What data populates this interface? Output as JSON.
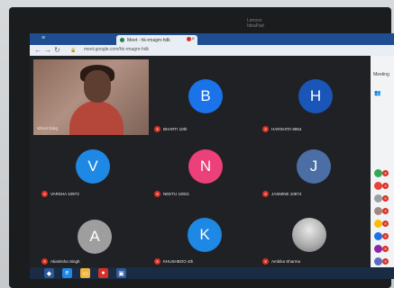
{
  "laptop": {
    "logo_text_1": "Lenovo",
    "logo_text_2": "IdeaPad"
  },
  "browser": {
    "active_tab_title": "Meet - hk-rmagm-hdk",
    "address": "meet.google.com/hk-rmagm-hdk"
  },
  "meet": {
    "self_name": "Shruti Garg",
    "tiles": [
      {
        "initial": "B",
        "name": "BHARTI 10th",
        "color": "#1a73e8"
      },
      {
        "initial": "H",
        "name": "HARSHITA 9854",
        "color": "#1a56b8"
      },
      {
        "initial": "V",
        "name": "VARSHA 10973",
        "color": "#1e88e5"
      },
      {
        "initial": "N",
        "name": "NEETU 10021",
        "color": "#ec407a"
      },
      {
        "initial": "J",
        "name": "JASMINE 10874",
        "color": "#4b6fa5"
      },
      {
        "initial": "A",
        "name": "Akanksha Singh",
        "color": "#9e9e9e"
      },
      {
        "initial": "K",
        "name": "KHUSHBOO 4th",
        "color": "#1e88e5"
      },
      {
        "initial": "",
        "name": "Ambika Sharma",
        "color": "#cccccc"
      }
    ]
  },
  "side_panel": {
    "title": "Meeting",
    "people_icon": "people-icon",
    "participants": [
      {
        "color": "#34a853"
      },
      {
        "color": "#ea4335"
      },
      {
        "color": "#9aa0a6"
      },
      {
        "color": "#a1887f"
      },
      {
        "color": "#fbbc04"
      },
      {
        "color": "#1a73e8"
      },
      {
        "color": "#8e24aa"
      },
      {
        "color": "#5c6bc0"
      },
      {
        "color": "#3949ab"
      }
    ]
  },
  "taskbar": {
    "items": [
      "start-icon",
      "ie-icon",
      "folder-icon",
      "chrome-icon",
      "store-icon"
    ]
  }
}
